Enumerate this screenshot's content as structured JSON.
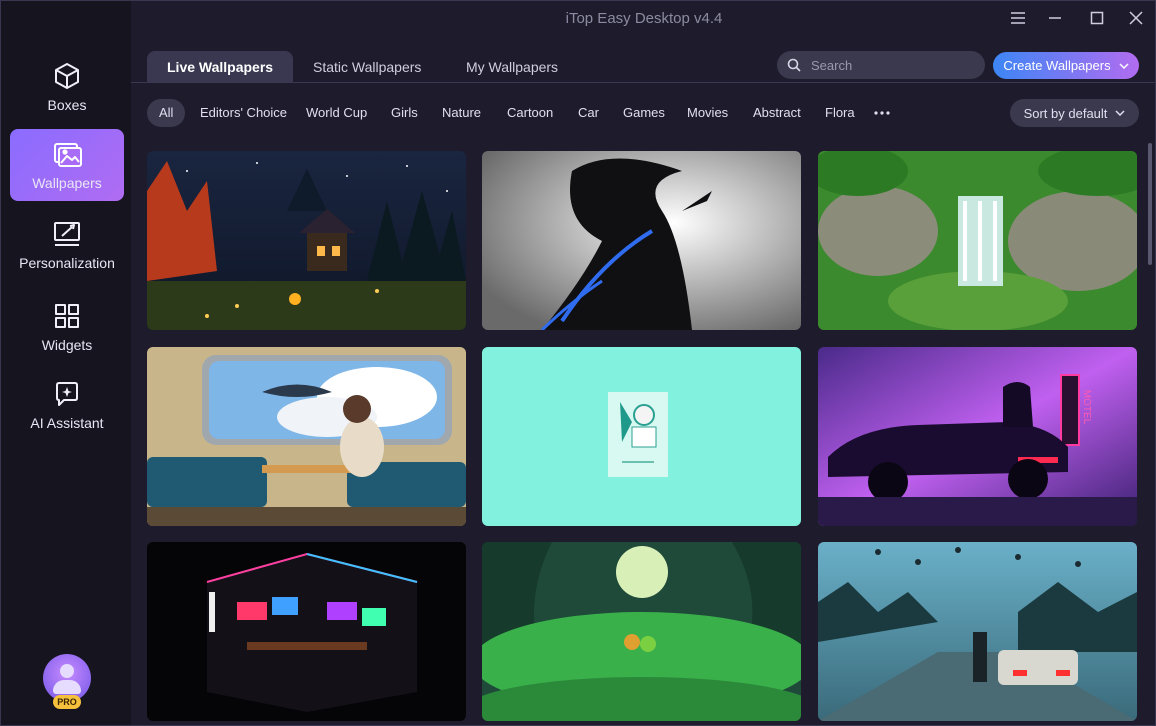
{
  "window": {
    "title": "iTop Easy Desktop v4.4"
  },
  "sidebar": {
    "items": [
      {
        "label": "Boxes",
        "icon": "cube-icon"
      },
      {
        "label": "Wallpapers",
        "icon": "image-icon",
        "active": true
      },
      {
        "label": "Personalization",
        "icon": "monitor-brush-icon"
      },
      {
        "label": "Widgets",
        "icon": "widgets-grid-icon"
      },
      {
        "label": "AI Assistant",
        "icon": "ai-sparkle-icon"
      }
    ],
    "badge": "PRO"
  },
  "tabs": [
    {
      "label": "Live Wallpapers",
      "active": true
    },
    {
      "label": "Static Wallpapers"
    },
    {
      "label": "My Wallpapers"
    }
  ],
  "search": {
    "placeholder": "Search",
    "value": ""
  },
  "create_button": {
    "label": "Create Wallpapers"
  },
  "categories": [
    "All",
    "Editors' Choice",
    "World Cup",
    "Girls",
    "Nature",
    "Cartoon",
    "Car",
    "Games",
    "Movies",
    "Abstract",
    "Flora"
  ],
  "active_category": "All",
  "sort": {
    "label": "Sort by default"
  },
  "wallpapers": [
    "Pixel cabin at night",
    "Anime swordsman silhouette",
    "Waterfall in mossy rocks",
    "Girl in train with whale",
    "Hatsune Miku on aqua",
    "Car under motel sign",
    "Neon gaming room",
    "Frogs under full moon",
    "Car in foggy rain"
  ],
  "motel_sign": "MOTEL",
  "colors": {
    "accent_start": "#8a6cff",
    "accent_end": "#b06cf2",
    "create_start": "#3d86f5",
    "create_end": "#b26cf0",
    "pro": "#f5c13d"
  }
}
